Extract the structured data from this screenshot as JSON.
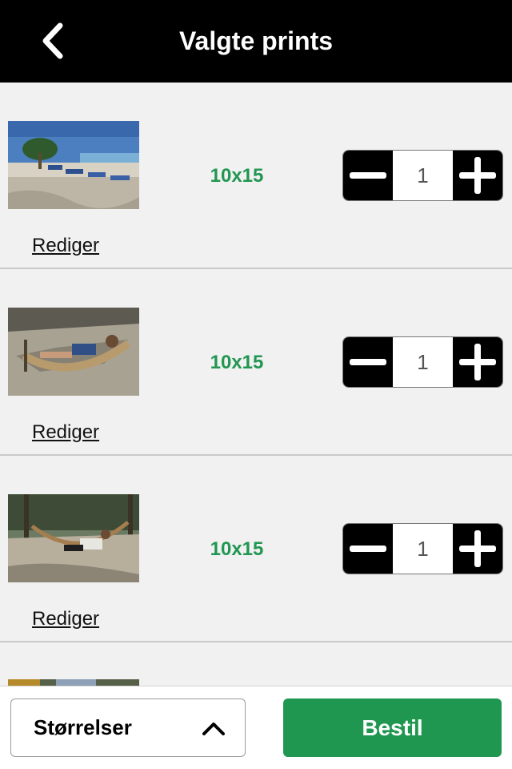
{
  "header": {
    "title": "Valgte prints",
    "back_icon": "chevron-left-icon"
  },
  "items": [
    {
      "size": "10x15",
      "quantity": "1",
      "edit_label": "Rediger",
      "photo": "beach with lounge chairs"
    },
    {
      "size": "10x15",
      "quantity": "1",
      "edit_label": "Rediger",
      "photo": "person in hammock"
    },
    {
      "size": "10x15",
      "quantity": "1",
      "edit_label": "Rediger",
      "photo": "person in hammock among trees"
    }
  ],
  "stepper_icons": {
    "minus": "minus-icon",
    "plus": "plus-icon"
  },
  "footer": {
    "sizes_label": "Størrelser",
    "sizes_icon": "chevron-up-icon",
    "order_label": "Bestil"
  },
  "colors": {
    "header_bg": "#000000",
    "accent_green": "#1f9751",
    "size_text": "#229653",
    "list_bg": "#f1f1f1"
  }
}
